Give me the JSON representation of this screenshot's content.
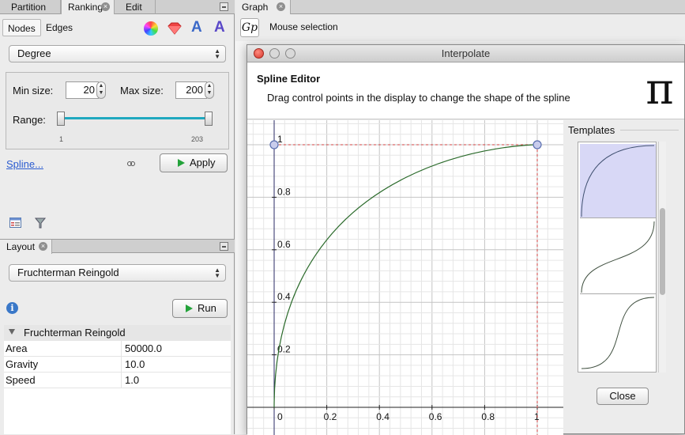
{
  "ranking_panel": {
    "tabs": [
      "Partition",
      "Ranking",
      "Edit"
    ],
    "subtabs": [
      "Nodes",
      "Edges"
    ],
    "attribute": "Degree",
    "min_size_label": "Min size:",
    "min_size": "20",
    "max_size_label": "Max size:",
    "max_size": "200",
    "range_label": "Range:",
    "range_min": "1",
    "range_max": "203",
    "spline_link": "Spline...",
    "apply": "Apply"
  },
  "layout_panel": {
    "tab": "Layout",
    "algorithm": "Fruchterman Reingold",
    "run": "Run",
    "section": "Fruchterman Reingold",
    "properties": [
      {
        "name": "Area",
        "value": "50000.0"
      },
      {
        "name": "Gravity",
        "value": "10.0"
      },
      {
        "name": "Speed",
        "value": "1.0"
      }
    ]
  },
  "graph_panel": {
    "tab": "Graph",
    "tool_label": "Mouse selection"
  },
  "dialog": {
    "title": "Interpolate",
    "heading": "Spline Editor",
    "description": "Drag control points in the display to change the shape of the spline",
    "pi_glyph": "π",
    "templates_label": "Templates",
    "close": "Close",
    "spline": {
      "control_points": [
        [
          0,
          1
        ],
        [
          1,
          1
        ]
      ],
      "x_ticks": [
        "0",
        "0.2",
        "0.4",
        "0.6",
        "0.8",
        "1"
      ],
      "y_ticks": [
        "0.2",
        "0.4",
        "0.6",
        "0.8",
        "1"
      ]
    }
  },
  "colors": {
    "accent": "#1fa8bf",
    "curve": "#2a6a2a",
    "control_point": "#5a6fb0",
    "guide": "#d04040"
  }
}
